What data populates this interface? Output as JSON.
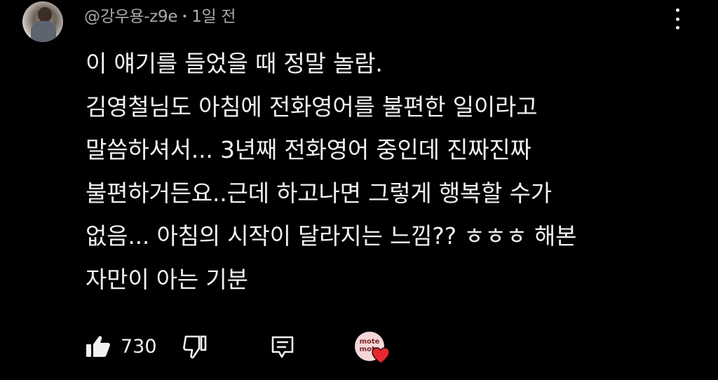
{
  "comment": {
    "author": "@강우용-z9e",
    "separator": "•",
    "time": "1일 전",
    "lines": [
      "이 얘기를 들었을 때 정말 놀람.",
      "김영철님도 아침에 전화영어를 불편한 일이라고",
      "말씀하셔서... 3년째 전화영어 중인데 진짜진짜",
      "불편하거든요..근데 하고나면 그렇게 행복할 수가",
      "없음... 아침의 시작이 달라지는 느낌?? ㅎㅎㅎ 해본",
      "자만이 아는 기분"
    ],
    "likes": "730",
    "creator_avatar_text": [
      "mote",
      "mote"
    ]
  },
  "icons": {
    "more": "more-vert-icon",
    "like": "thumb-up-icon",
    "dislike": "thumb-down-icon",
    "reply": "reply-icon",
    "heart": "creator-heart-icon"
  },
  "colors": {
    "background": "#000000",
    "text": "#f1f1f1",
    "meta": "#aaaaaa",
    "heart": "#e8282f",
    "creator_avatar_bg": "#f5d6d6"
  }
}
